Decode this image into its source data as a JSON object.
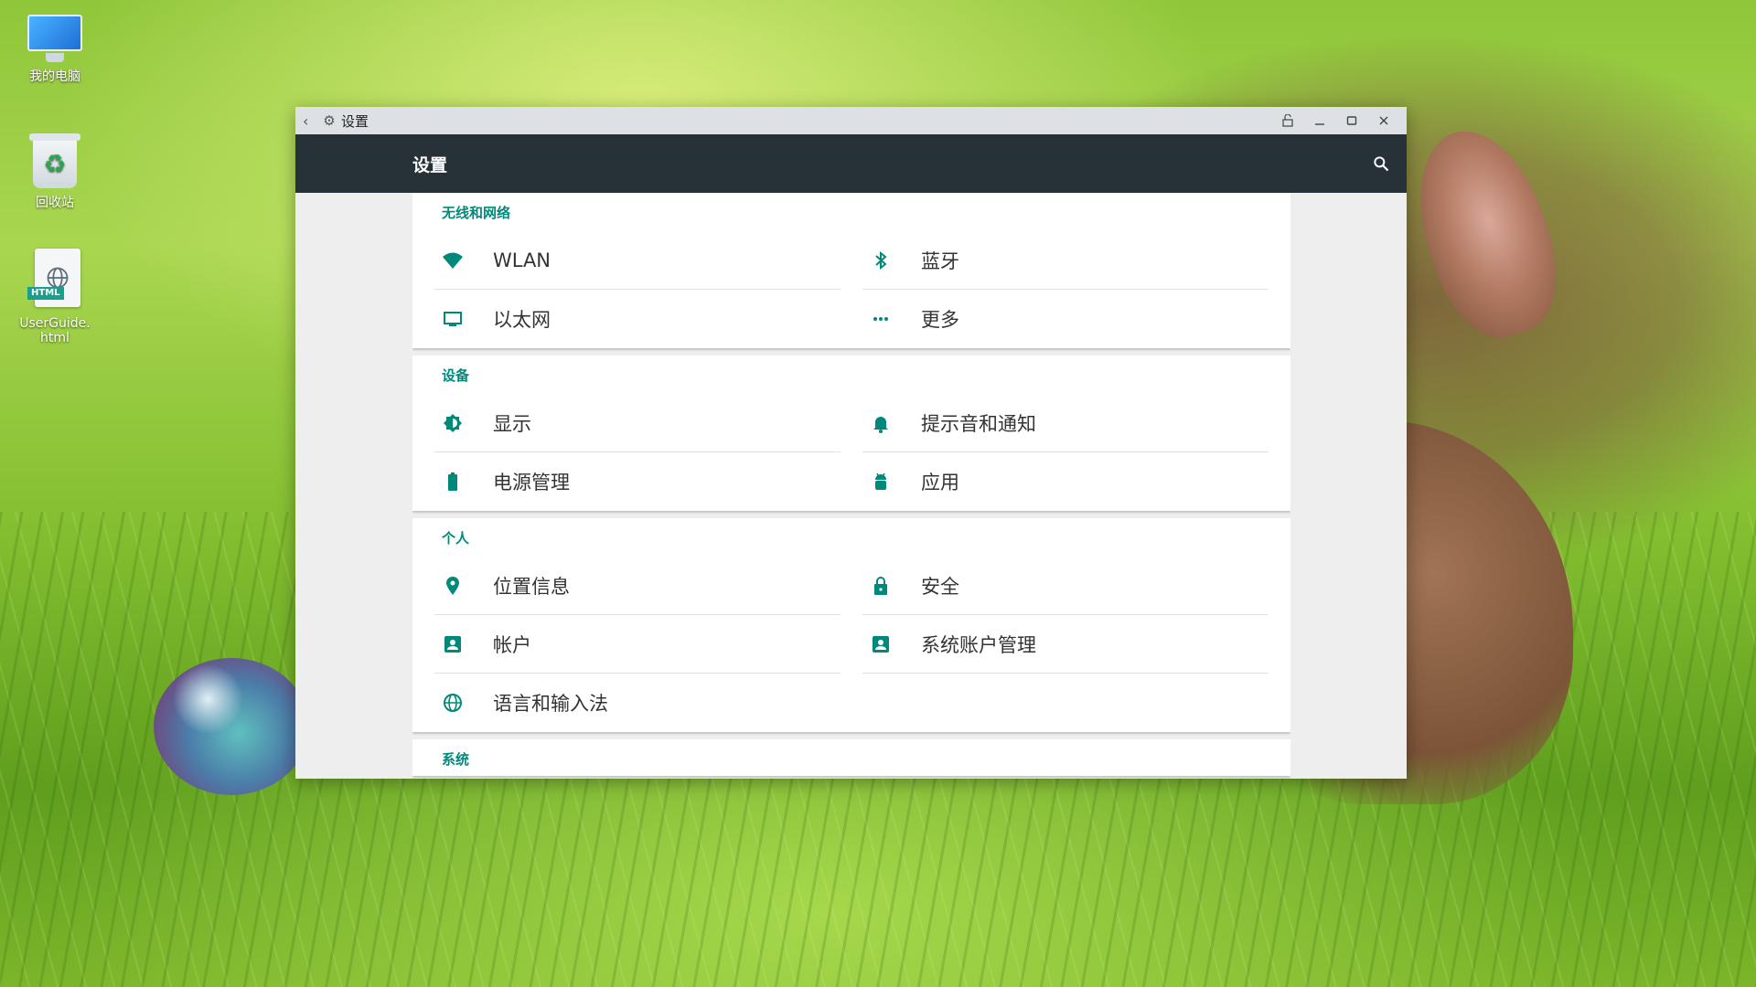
{
  "desktop": {
    "icons": [
      {
        "label": "我的电脑",
        "icon": "computer-icon"
      },
      {
        "label": "回收站",
        "icon": "recycle-bin-icon"
      },
      {
        "label": "UserGuide.html",
        "icon": "html-file-icon",
        "badge": "HTML"
      }
    ]
  },
  "window": {
    "title": "设置",
    "controls": [
      "pin",
      "minimize",
      "maximize",
      "close"
    ]
  },
  "appbar": {
    "title": "设置",
    "search_icon": "search-icon"
  },
  "sections": [
    {
      "header": "无线和网络",
      "items": [
        {
          "label": "WLAN",
          "icon": "wifi-icon"
        },
        {
          "label": "蓝牙",
          "icon": "bluetooth-icon"
        },
        {
          "label": "以太网",
          "icon": "monitor-icon"
        },
        {
          "label": "更多",
          "icon": "more-icon"
        }
      ]
    },
    {
      "header": "设备",
      "items": [
        {
          "label": "显示",
          "icon": "brightness-icon"
        },
        {
          "label": "提示音和通知",
          "icon": "bell-icon"
        },
        {
          "label": "电源管理",
          "icon": "battery-icon"
        },
        {
          "label": "应用",
          "icon": "android-icon"
        }
      ]
    },
    {
      "header": "个人",
      "items": [
        {
          "label": "位置信息",
          "icon": "location-icon"
        },
        {
          "label": "安全",
          "icon": "lock-icon"
        },
        {
          "label": "帐户",
          "icon": "account-icon"
        },
        {
          "label": "系统账户管理",
          "icon": "account-icon"
        },
        {
          "label": "语言和输入法",
          "icon": "globe-icon"
        }
      ]
    },
    {
      "header": "系统",
      "items": []
    }
  ],
  "colors": {
    "accent": "#00897b",
    "appbar": "#263238",
    "titlebar": "#dde1e5"
  }
}
